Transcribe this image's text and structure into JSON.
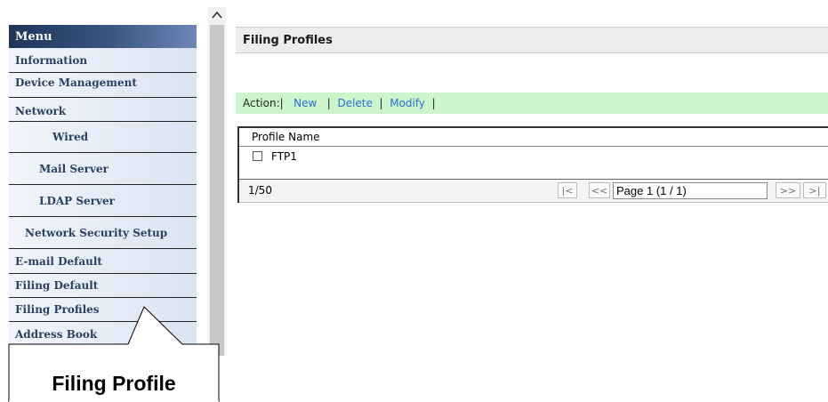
{
  "sidebar": {
    "header": "Menu",
    "items": [
      {
        "label": "Information"
      },
      {
        "label": "Device Management"
      },
      {
        "label": "Network"
      },
      {
        "label": "Wired"
      },
      {
        "label": "Mail Server"
      },
      {
        "label": "LDAP Server"
      },
      {
        "label": "Network Security Setup"
      },
      {
        "label": "E-mail Default"
      },
      {
        "label": "Filing Default"
      },
      {
        "label": "Filing Profiles"
      },
      {
        "label": "Address Book"
      }
    ]
  },
  "callout": {
    "label": "Filing Profile"
  },
  "main": {
    "title": "Filing Profiles",
    "action_bar": {
      "prefix": "Action:|",
      "new_label": "New",
      "sep1": "|",
      "delete_label": "Delete",
      "sep2": "|",
      "modify_label": "Modify",
      "sep3": "|"
    },
    "table": {
      "column_header": "Profile Name",
      "rows": [
        {
          "name": "FTP1",
          "checked": false
        }
      ],
      "footer": {
        "count": "1/50",
        "first": "|<",
        "prev": "<<",
        "page_value": "Page 1 (1 / 1)",
        "next": ">>",
        "last": ">|"
      }
    }
  },
  "colors": {
    "menu_header": "#3a5683",
    "menu_item_text": "#2b4063",
    "action_bar_bg": "#ccf5cc",
    "link": "#2a6fd6"
  },
  "icons": {
    "scroll_up": "chevron-up-icon"
  }
}
